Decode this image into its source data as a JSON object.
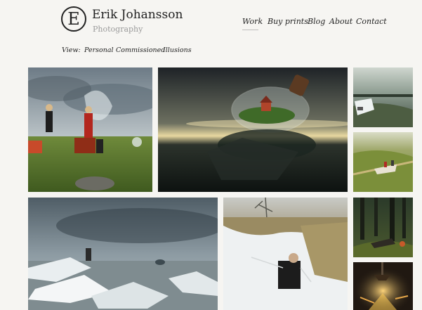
{
  "brand": {
    "logo_letter": "E",
    "name": "Erik Johansson",
    "subtitle": "Photography"
  },
  "nav": {
    "items": [
      "Work",
      "Buy prints",
      "Blog",
      "About",
      "Contact"
    ],
    "active": "Work"
  },
  "view_filter": {
    "label": "View:",
    "options": [
      "Personal",
      "Commissioned",
      "Illusions"
    ]
  },
  "gallery": {
    "photos": [
      {
        "subject": "girl-pulling-sky-photo"
      },
      {
        "subject": "island-in-bottle-photo"
      },
      {
        "subject": "car-on-road-photo"
      },
      {
        "subject": "boat-on-field-photo"
      },
      {
        "subject": "shattered-ice-sea-photo"
      },
      {
        "subject": "man-zipping-snow-photo"
      },
      {
        "subject": "forest-figure-photo"
      },
      {
        "subject": "glowing-lamp-photo"
      }
    ]
  },
  "colors": {
    "page_background": "#f6f5f2",
    "text": "#222222",
    "muted_text": "#9a9a9a"
  }
}
